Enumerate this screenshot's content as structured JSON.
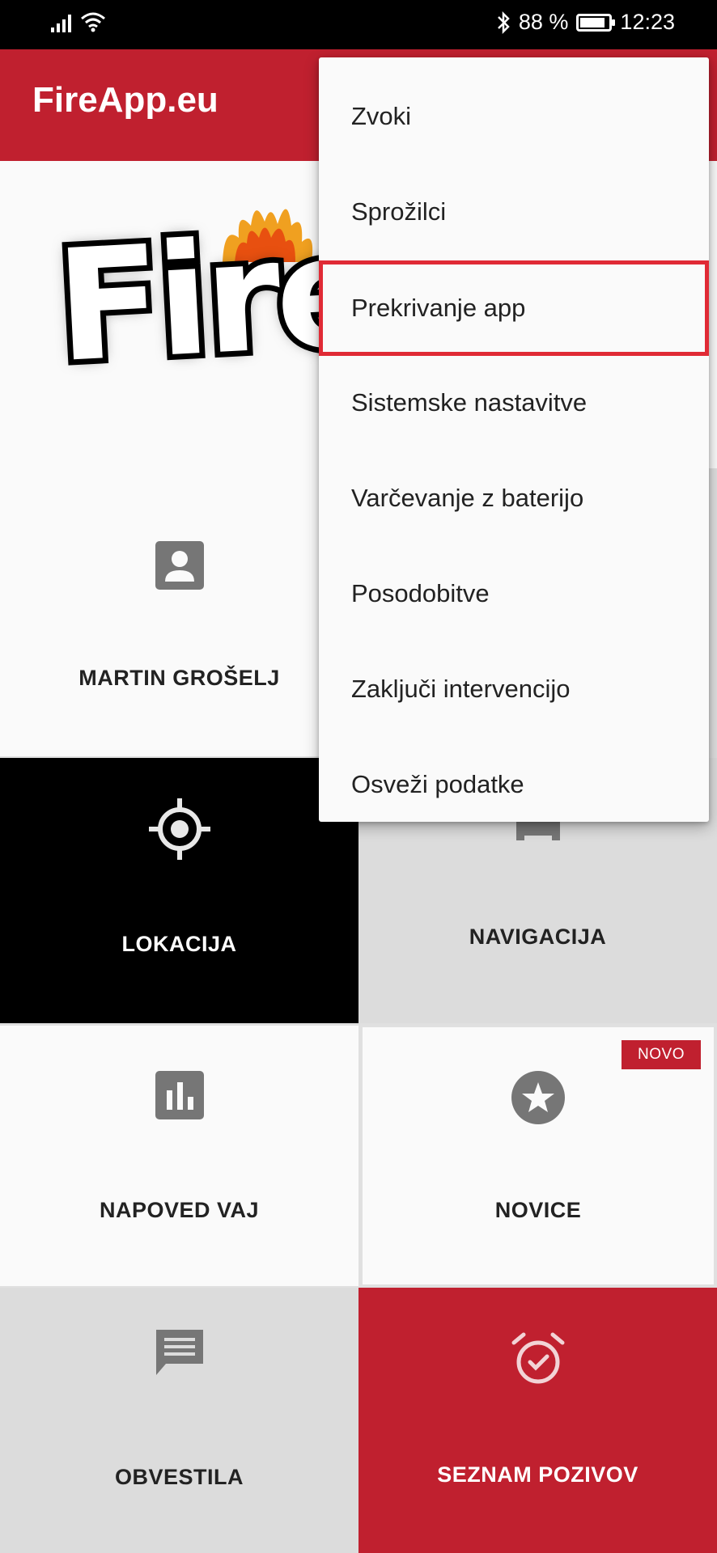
{
  "status_bar": {
    "battery": "88 %",
    "battery_level": 0.88,
    "time": "12:23"
  },
  "app_bar": {
    "title": "FireApp.eu",
    "color": "#c0202f"
  },
  "logo": {
    "text": "Fire"
  },
  "menu": {
    "items": [
      {
        "label": "Zvoki"
      },
      {
        "label": "Sprožilci"
      },
      {
        "label": "Prekrivanje app",
        "highlighted": true
      },
      {
        "label": "Sistemske nastavitve"
      },
      {
        "label": "Varčevanje z baterijo"
      },
      {
        "label": "Posodobitve"
      },
      {
        "label": "Zaključi intervencijo"
      },
      {
        "label": "Osveži podatke"
      }
    ]
  },
  "tiles": {
    "profile": {
      "label": "MARTIN GROŠELJ",
      "icon": "account-box-icon"
    },
    "location": {
      "label": "LOKACIJA",
      "icon": "gps-location-icon"
    },
    "navigation": {
      "label": "NAVIGACIJA",
      "icon": "car-icon"
    },
    "forecast": {
      "label": "NAPOVED VAJ",
      "icon": "bar-chart-icon"
    },
    "news": {
      "label": "NOVICE",
      "icon": "star-icon",
      "badge": "NOVO"
    },
    "notices": {
      "label": "OBVESTILA",
      "icon": "message-icon"
    },
    "calls": {
      "label": "SEZNAM POZIVOV",
      "icon": "alarm-check-icon"
    }
  },
  "colors": {
    "accent": "#c0202f",
    "highlight_outline": "#e02a35"
  }
}
